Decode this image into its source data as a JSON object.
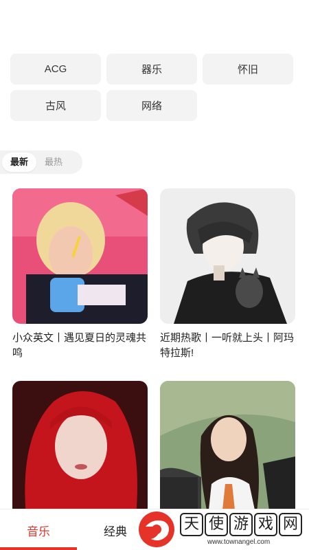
{
  "tags": [
    [
      "ACG",
      "器乐",
      "怀旧"
    ],
    [
      "古风",
      "网络"
    ]
  ],
  "sort": {
    "options": [
      "最新",
      "最热"
    ],
    "active": "最新"
  },
  "cards": [
    {
      "title": "小众英文丨遇见夏日的灵魂共鸣",
      "image": "photo-girl-pink-drink"
    },
    {
      "title": "近期热歌丨一听就上头丨阿玛特拉斯!",
      "image": "anime-boy-with-cat"
    },
    {
      "title": "",
      "image": "photo-red-hair-girl"
    },
    {
      "title": "",
      "image": "photo-girl-by-car"
    }
  ],
  "tabbar": {
    "items": [
      "音乐",
      "经典"
    ],
    "active": "音乐"
  },
  "watermark": {
    "chars": [
      "天",
      "使",
      "游",
      "戏",
      "网"
    ],
    "url": "www.townangel.com"
  },
  "colors": {
    "accent": "#e5332a",
    "tag_bg": "#f3f3f3"
  }
}
